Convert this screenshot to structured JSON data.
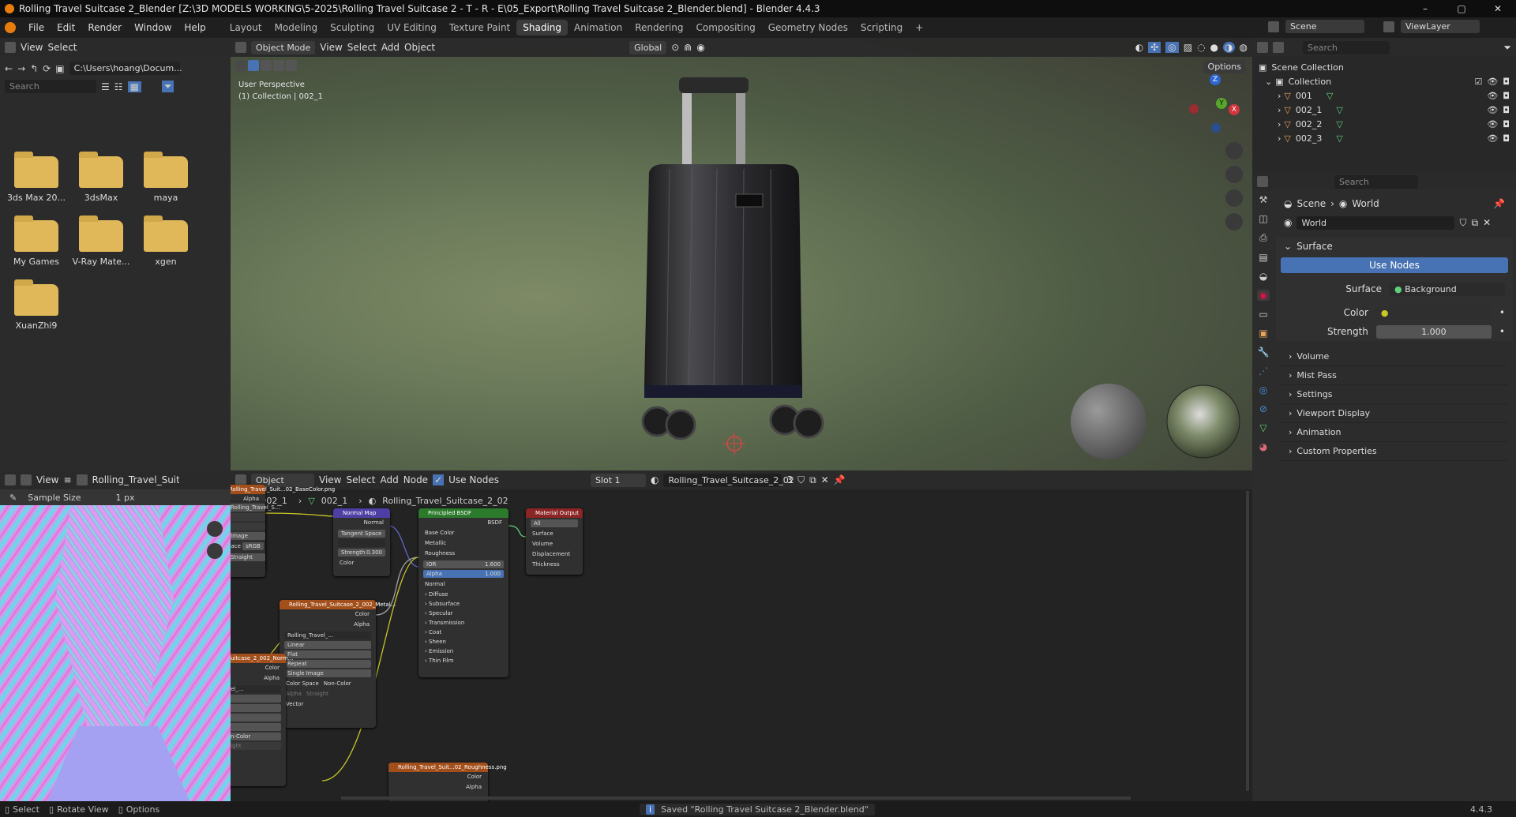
{
  "window_title": "Rolling Travel Suitcase 2_Blender [Z:\\3D MODELS WORKING\\5-2025\\Rolling Travel Suitcase 2 - T - R - E\\05_Export\\Rolling Travel Suitcase 2_Blender.blend] - Blender 4.4.3",
  "menu": [
    "File",
    "Edit",
    "Render",
    "Window",
    "Help"
  ],
  "workspaces": [
    "Layout",
    "Modeling",
    "Sculpting",
    "UV Editing",
    "Texture Paint",
    "Shading",
    "Animation",
    "Rendering",
    "Compositing",
    "Geometry Nodes",
    "Scripting"
  ],
  "active_workspace": "Shading",
  "top_right": {
    "scene": "Scene",
    "view_layer": "ViewLayer"
  },
  "file_browser": {
    "menu": [
      "View",
      "Select"
    ],
    "path": "C:\\Users\\hoang\\Docum...",
    "search_placeholder": "Search",
    "folders": [
      "3ds Max 20...",
      "3dsMax",
      "maya",
      "My Games",
      "V-Ray Mate...",
      "xgen",
      "XuanZhi9"
    ]
  },
  "viewport": {
    "mode": "Object Mode",
    "menu": [
      "View",
      "Select",
      "Add",
      "Object"
    ],
    "orientation": "Global",
    "options": "Options",
    "overlay_line1": "User Perspective",
    "overlay_line2": "(1) Collection | 002_1",
    "gizmo": {
      "z": "Z",
      "y": "Y",
      "x": "X"
    }
  },
  "outliner": {
    "search_placeholder": "Search",
    "scene_collection": "Scene Collection",
    "collection": "Collection",
    "objects": [
      "001",
      "002_1",
      "002_2",
      "002_3"
    ]
  },
  "properties": {
    "search_placeholder": "Search",
    "breadcrumb": [
      "Scene",
      "World"
    ],
    "world_name": "World",
    "surface_panel": "Surface",
    "use_nodes": "Use Nodes",
    "surface_label": "Surface",
    "surface_value": "Background",
    "color_label": "Color",
    "strength_label": "Strength",
    "strength_value": "1.000",
    "collapsed_panels": [
      "Volume",
      "Mist Pass",
      "Settings",
      "Viewport Display",
      "Animation",
      "Custom Properties"
    ]
  },
  "image_editor": {
    "view": "View",
    "image_name": "Rolling_Travel_Suitcas",
    "sample_size_label": "Sample Size",
    "sample_size_value": "1 px"
  },
  "node_editor": {
    "object_mode": "Object",
    "menu": [
      "View",
      "Select",
      "Add",
      "Node"
    ],
    "use_nodes": "Use Nodes",
    "slot": "Slot 1",
    "material": "Rolling_Travel_Suitcase_2_02",
    "users": "3",
    "breadcrumb": [
      "002_1",
      "002_1",
      "Rolling_Travel_Suitcase_2_02"
    ],
    "nodes": {
      "normal_map": {
        "title": "Normal Map",
        "out": "Normal",
        "space": "Tangent Space",
        "strength_label": "Strength",
        "strength": "0.300",
        "in_color": "Color"
      },
      "principled": {
        "title": "Principled BSDF",
        "out": "BSDF",
        "inputs": [
          "Base Color",
          "Metallic",
          "Roughness"
        ],
        "ior_label": "IOR",
        "ior": "1.600",
        "alpha_label": "Alpha",
        "alpha": "1.000",
        "normal": "Normal",
        "panels": [
          "Diffuse",
          "Subsurface",
          "Specular",
          "Transmission",
          "Coat",
          "Sheen",
          "Emission",
          "Thin Film"
        ]
      },
      "material_output": {
        "title": "Material Output",
        "target": "All",
        "inputs": [
          "Surface",
          "Volume",
          "Displacement",
          "Thickness"
        ]
      },
      "metal_tex": {
        "title": "Rolling_Travel_Suitcase_2_002_Metal...",
        "color": "Color",
        "alpha": "Alpha",
        "image": "Rolling_Travel_...",
        "interp": "Linear",
        "proj": "Flat",
        "ext": "Repeat",
        "source": "Single Image",
        "cs_label": "Color Space",
        "cs": "Non-Color",
        "alpha_label": "Alpha",
        "alpha_mode": "Straight",
        "vector": "Vector"
      },
      "base_tex": {
        "title": "Rolling_Travel_Suit...02_BaseColor.png",
        "alpha": "Alpha",
        "image": "Rolling_Travel_S...",
        "src": "Image",
        "cs_label": "pace",
        "cs": "sRGB",
        "alpha_mode": "Straight"
      },
      "norm_tex": {
        "title": "uitcase_2_002_Norm...",
        "color": "Color",
        "alpha": "Alpha",
        "image": "el_...",
        "cs": "n-Color",
        "alpha_mode": "ight"
      },
      "rough_tex": {
        "title": "Rolling_Travel_Suit...02_Roughness.png",
        "color": "Color",
        "alpha": "Alpha"
      }
    }
  },
  "status": {
    "left": [
      "Select",
      "Rotate View",
      "Options"
    ],
    "message": "Saved \"Rolling Travel Suitcase 2_Blender.blend\"",
    "version": "4.4.3"
  },
  "colors": {
    "accent": "#4772b3",
    "blender_orange": "#e87d0d",
    "node_header_shader": "#2c7a2c",
    "node_header_texture": "#a34f1b",
    "node_header_vector": "#4d3fa3",
    "node_header_output": "#8c2525",
    "socket_yellow": "#c7c729",
    "socket_green": "#63c763",
    "socket_grey": "#a1a1a1",
    "socket_purple": "#6363c7"
  }
}
